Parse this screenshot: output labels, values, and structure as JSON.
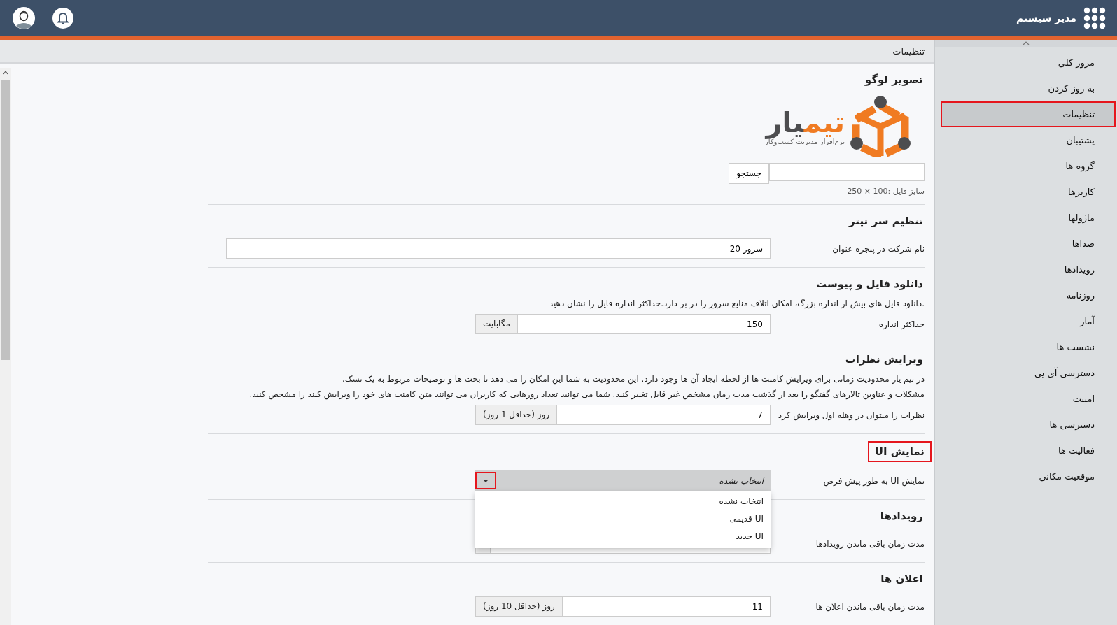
{
  "header": {
    "title": "مدیر سیستم"
  },
  "breadcrumb": "تنظیمات",
  "sidebar": {
    "items": [
      {
        "label": "مرور کلی",
        "selected": false
      },
      {
        "label": "به روز کردن",
        "selected": false
      },
      {
        "label": "تنظیمات",
        "selected": true
      },
      {
        "label": "پشتیبان",
        "selected": false
      },
      {
        "label": "گروه ها",
        "selected": false
      },
      {
        "label": "کاربرها",
        "selected": false
      },
      {
        "label": "ماژولها",
        "selected": false
      },
      {
        "label": "صداها",
        "selected": false
      },
      {
        "label": "رویدادها",
        "selected": false
      },
      {
        "label": "روزنامه",
        "selected": false
      },
      {
        "label": "آمار",
        "selected": false
      },
      {
        "label": "نشست ها",
        "selected": false
      },
      {
        "label": "دسترسی آی پی",
        "selected": false
      },
      {
        "label": "امنیت",
        "selected": false
      },
      {
        "label": "دسترسی ها",
        "selected": false
      },
      {
        "label": "فعالیت ها",
        "selected": false
      },
      {
        "label": "موقعیت مکانی",
        "selected": false
      }
    ]
  },
  "sections": [
    {
      "kind": "logo",
      "title": "تصویر لوگو",
      "highlighted": false,
      "logo": {
        "name_part_1": "تیم",
        "name_part_2": "یار",
        "tagline": "نرم‌افزار مدیریت کسب‌وکار"
      },
      "button": "جستجو",
      "hint": "سایز فایل :100 × 250"
    },
    {
      "kind": "fields",
      "title": "تنظیم سر تیتر",
      "highlighted": false,
      "fields": [
        {
          "kind": "text",
          "label": "نام شرکت در پنجره عنوان",
          "value": "سرور 20"
        }
      ]
    },
    {
      "kind": "fields",
      "title": "دانلود فایل و پیوست",
      "highlighted": false,
      "description": [
        ".دانلود فایل های بیش از اندازه بزرگ، امکان اتلاف منابع سرور را در بر دارد.حداکثر اندازه فایل را نشان دهید"
      ],
      "fields": [
        {
          "kind": "addon",
          "label": "حداکثر اندازه",
          "value": "150",
          "addon": "مگابایت"
        }
      ]
    },
    {
      "kind": "fields",
      "title": "ویرایش نظرات",
      "highlighted": false,
      "description": [
        "در تیم یار محدودیت زمانی برای ویرایش کامنت ها از لحظه ایجاد آن ها وجود دارد. این محدودیت به شما این امکان را می دهد تا بحث ها و توضیحات مربوط به یک تسک،",
        "مشکلات و عناوین تالارهای گفتگو را بعد از گذشت مدت زمان مشخص غیر قابل تغییر کنید. شما می توانید تعداد روزهایی که کاربران می توانند متن کامنت های خود را ویرایش کنند را مشخص کنید."
      ],
      "fields": [
        {
          "kind": "addon",
          "label": "نظرات را میتوان در وهله اول ویرایش کرد",
          "value": "7",
          "addon": "روز (حداقل 1 روز)"
        }
      ]
    },
    {
      "kind": "fields",
      "title": "نمایش UI",
      "highlighted": true,
      "fields": [
        {
          "kind": "select",
          "label": "نمایش UI به طور پیش فرض",
          "value": "انتخاب نشده",
          "expanded": true,
          "caret_highlighted": true,
          "options": [
            "انتخاب نشده",
            "UI قدیمی",
            "UI جدید"
          ]
        }
      ]
    },
    {
      "kind": "fields",
      "title": "رویدادها",
      "highlighted": false,
      "fields": [
        {
          "kind": "addon",
          "label": "مدت زمان باقی ماندن رویدادها"
        }
      ]
    },
    {
      "kind": "fields",
      "title": "اعلان ها",
      "highlighted": false,
      "fields": [
        {
          "kind": "addon",
          "label": "مدت زمان باقی ماندن اعلان ها",
          "value": "11",
          "addon": "روز (حداقل 10 روز)"
        }
      ]
    }
  ]
}
